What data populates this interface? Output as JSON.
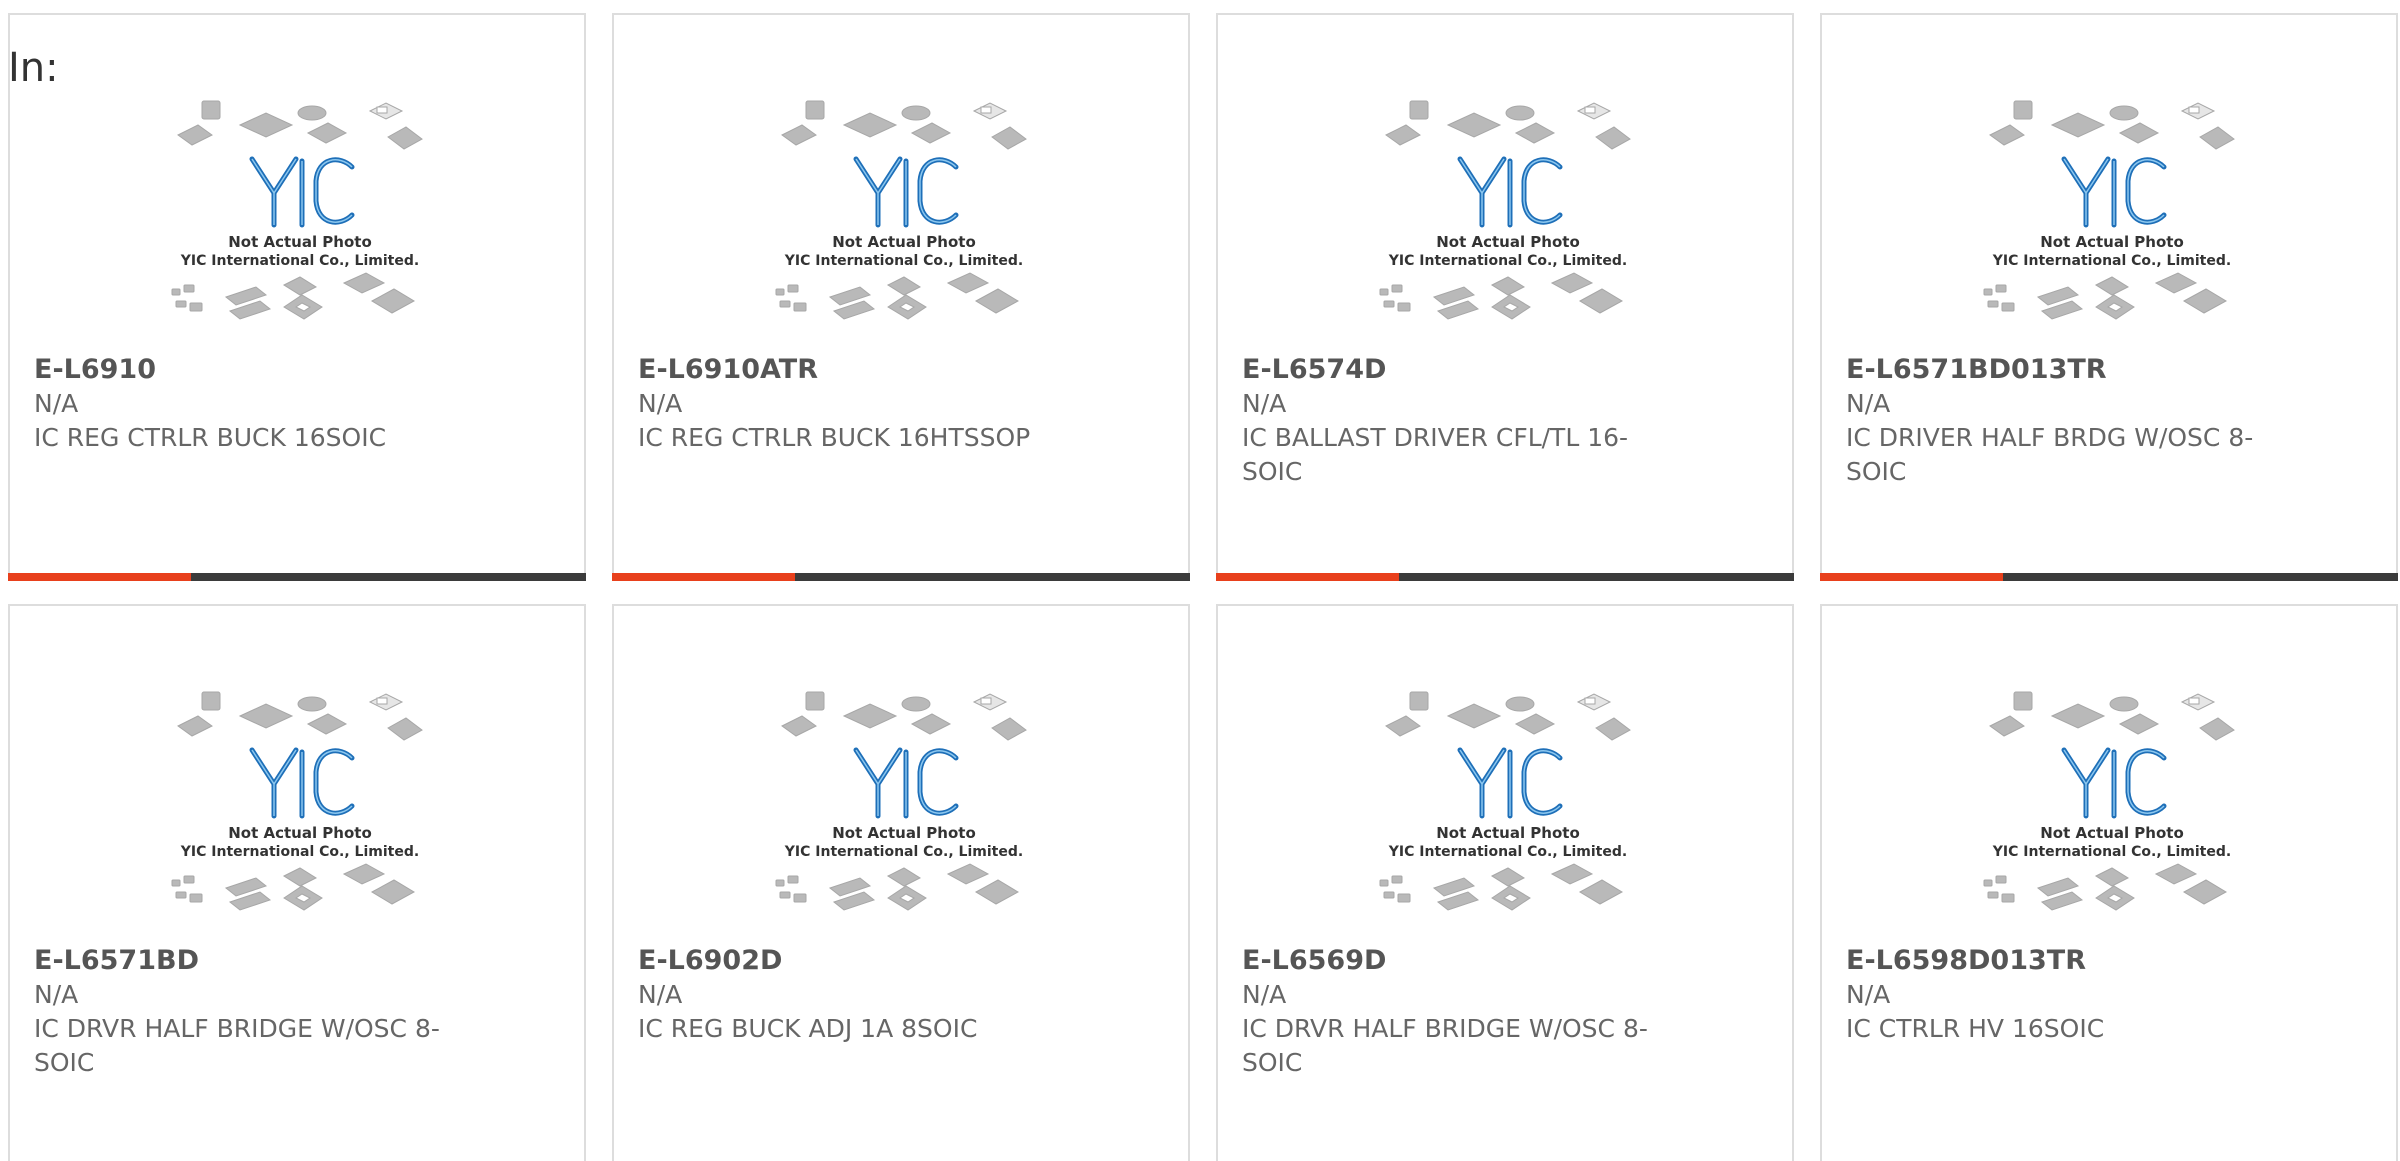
{
  "header": {
    "in_label": "In:"
  },
  "colors": {
    "accent": "#e8401c",
    "bar_dark": "#3b3b3b"
  },
  "thumbnail": {
    "line1": "Not Actual Photo",
    "line2": "YIC International Co., Limited.",
    "logo_text": "YIC"
  },
  "products": [
    {
      "part_number": "E-L6910",
      "manufacturer": "N/A",
      "description": "IC REG CTRLR BUCK 16SOIC"
    },
    {
      "part_number": "E-L6910ATR",
      "manufacturer": "N/A",
      "description": "IC REG CTRLR BUCK 16HTSSOP"
    },
    {
      "part_number": "E-L6574D",
      "manufacturer": "N/A",
      "description": "IC BALLAST DRIVER CFL/TL 16-SOIC"
    },
    {
      "part_number": "E-L6571BD013TR",
      "manufacturer": "N/A",
      "description": "IC DRIVER HALF BRDG W/OSC 8-SOIC"
    },
    {
      "part_number": "E-L6571BD",
      "manufacturer": "N/A",
      "description": "IC DRVR HALF BRIDGE W/OSC 8-SOIC"
    },
    {
      "part_number": "E-L6902D",
      "manufacturer": "N/A",
      "description": "IC REG BUCK ADJ 1A 8SOIC"
    },
    {
      "part_number": "E-L6569D",
      "manufacturer": "N/A",
      "description": "IC DRVR HALF BRIDGE W/OSC 8-SOIC"
    },
    {
      "part_number": "E-L6598D013TR",
      "manufacturer": "N/A",
      "description": "IC CTRLR HV 16SOIC"
    }
  ]
}
